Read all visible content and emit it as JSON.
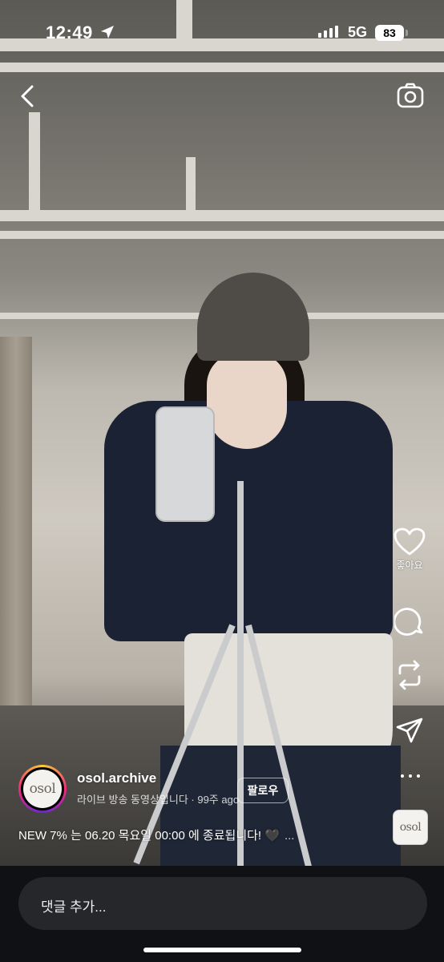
{
  "status_bar": {
    "time": "12:49",
    "network": "5G",
    "battery": "83"
  },
  "profile": {
    "username": "osol.archive",
    "subtitle": "라이브 방송 동영상입니다 · 99주 ago",
    "avatar_logo": "osol",
    "follow_label": "팔로우"
  },
  "post": {
    "caption": "NEW 7% 는 06.20 목요일 00:00 에 종료됩니다! 🖤",
    "caption_more": "..."
  },
  "actions": {
    "like_label": "좋아요",
    "like_icon": "heart-icon",
    "comment_icon": "comment-icon",
    "repost_icon": "repost-icon",
    "share_icon": "send-icon",
    "more_icon": "more-dots-icon"
  },
  "audio": {
    "logo": "osol"
  },
  "comment": {
    "placeholder": "댓글 추가..."
  },
  "colors": {
    "bottom_bar": "#0f1115",
    "comment_box": "#25272b",
    "story_ring": [
      "#f9ce34",
      "#ee2a7b",
      "#6228d7"
    ]
  }
}
